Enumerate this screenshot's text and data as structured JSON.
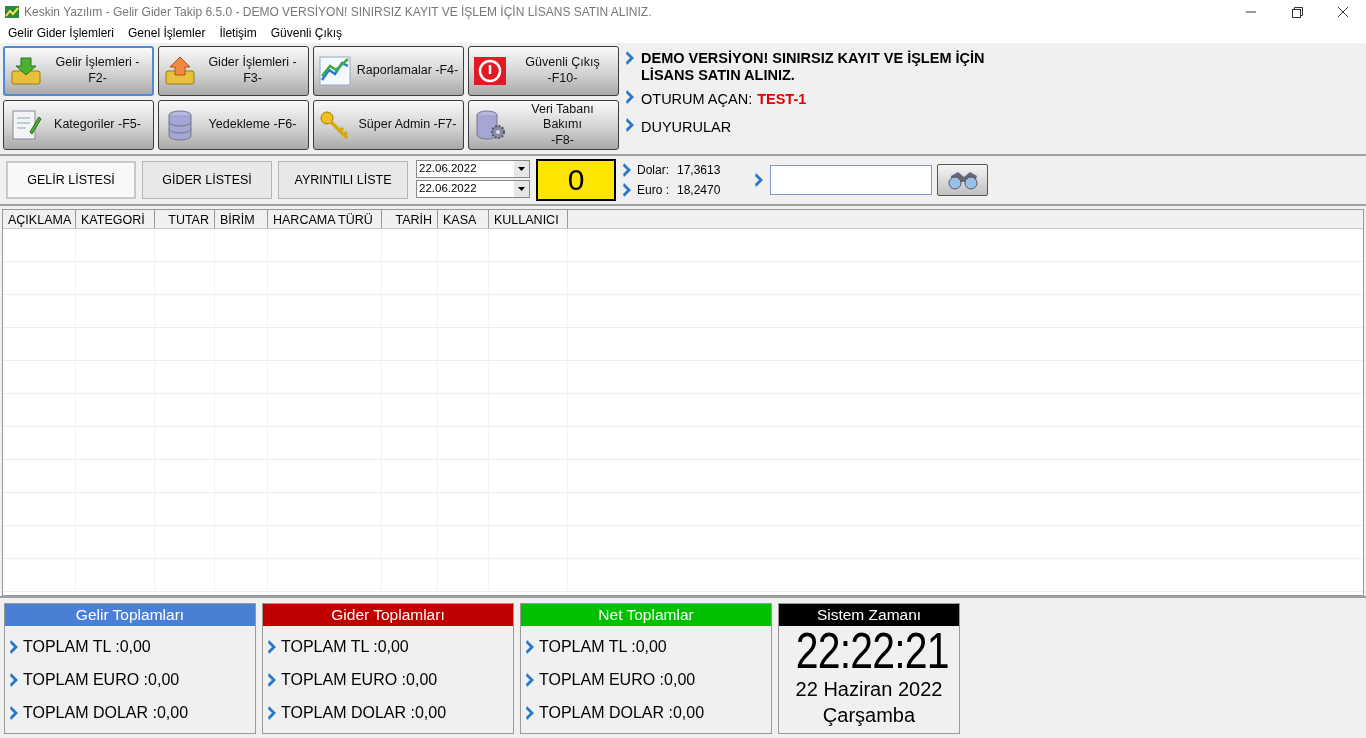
{
  "window": {
    "title": "Keskin Yazılım - Gelir Gider Takip 6.5.0  - DEMO VERSİYON! SINIRSIZ KAYIT VE İŞLEM İÇİN LİSANS SATIN ALINIZ."
  },
  "menu": [
    "Gelir Gider İşlemleri",
    "Genel İşlemler",
    "İletişim",
    "Güvenli Çıkış"
  ],
  "toolbar": [
    {
      "kind": "income",
      "lines": [
        "Gelir İşlemleri -F2-"
      ],
      "focused": true
    },
    {
      "kind": "expense",
      "lines": [
        "Gider İşlemleri -F3-"
      ],
      "focused": false
    },
    {
      "kind": "reports",
      "lines": [
        "Raporlamalar -F4-"
      ],
      "focused": false
    },
    {
      "kind": "exit",
      "lines": [
        "Güvenli Çıkış",
        "-F10-"
      ],
      "focused": false
    },
    {
      "kind": "categories",
      "lines": [
        "Kategoriler -F5-"
      ],
      "focused": false
    },
    {
      "kind": "backup",
      "lines": [
        "Yedekleme -F6-"
      ],
      "focused": false
    },
    {
      "kind": "admin",
      "lines": [
        "Süper Admin -F7-"
      ],
      "focused": false
    },
    {
      "kind": "database",
      "lines": [
        "Veri Tabanı Bakımı",
        "-F8-"
      ],
      "focused": false
    }
  ],
  "info": {
    "notice": "DEMO VERSİYON! SINIRSIZ KAYIT VE İŞLEM İÇİN LİSANS SATIN ALINIZ.",
    "session_label": "OTURUM AÇAN:",
    "session_user": "TEST-1",
    "announcements": "DUYURULAR"
  },
  "list_tabs": [
    {
      "label": "GELİR LİSTESİ",
      "selected": true
    },
    {
      "label": "GİDER LİSTESİ",
      "selected": false
    },
    {
      "label": "AYRINTILI LİSTE",
      "selected": false
    }
  ],
  "dates": [
    "22.06.2022",
    "22.06.2022"
  ],
  "counter": "0",
  "rates": [
    {
      "label": "Dolar:",
      "value": "17,3613"
    },
    {
      "label": "Euro :",
      "value": "18,2470"
    }
  ],
  "table": {
    "columns": [
      "AÇIKLAMA",
      "KATEGORİ",
      "TUTAR",
      "BİRİM",
      "HARCAMA TÜRÜ",
      "TARİH",
      "KASA",
      "KULLANICI"
    ]
  },
  "totals": [
    {
      "title": "Gelir Toplamları",
      "color": "#4a7fd6",
      "lines": [
        "TOPLAM TL :0,00",
        "TOPLAM EURO :0,00",
        "TOPLAM DOLAR :0,00"
      ]
    },
    {
      "title": "Gider Toplamları",
      "color": "#c00000",
      "lines": [
        "TOPLAM TL :0,00",
        "TOPLAM EURO :0,00",
        "TOPLAM DOLAR :0,00"
      ]
    },
    {
      "title": "Net Toplamlar",
      "color": "#00c000",
      "lines": [
        "TOPLAM TL :0,00",
        "TOPLAM EURO :0,00",
        "TOPLAM DOLAR :0,00"
      ]
    }
  ],
  "clock": {
    "title": "Sistem Zamanı",
    "time": "22:22:21",
    "date": "22 Haziran 2022",
    "day": "Çarşamba"
  }
}
